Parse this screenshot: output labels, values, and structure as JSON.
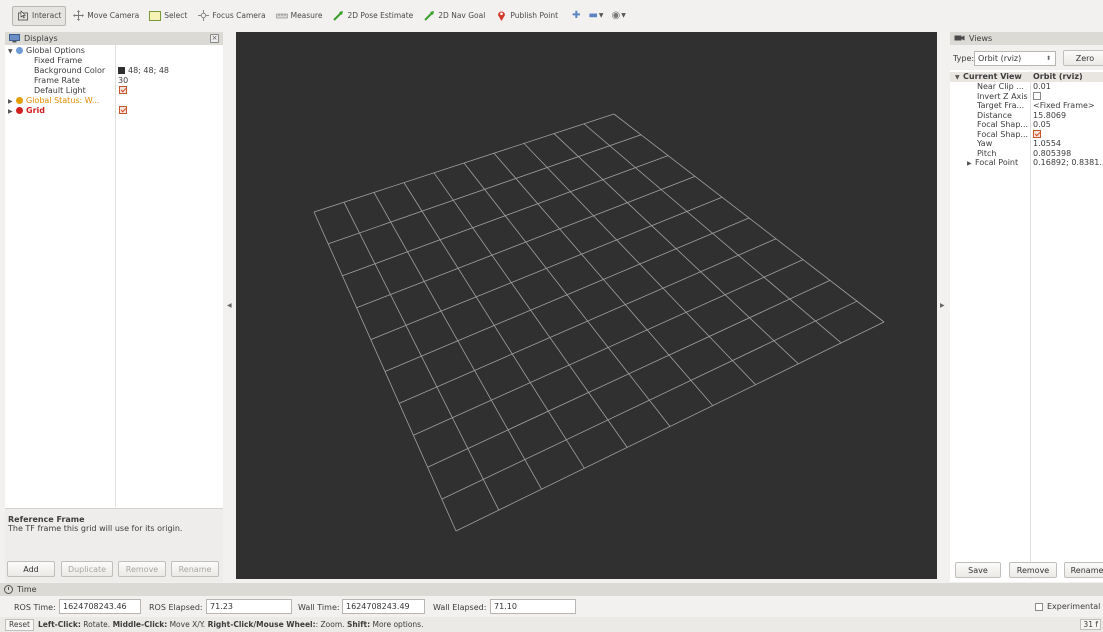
{
  "toolbar": {
    "interact": "Interact",
    "move_camera": "Move Camera",
    "select": "Select",
    "focus_camera": "Focus Camera",
    "measure": "Measure",
    "pose_estimate": "2D Pose Estimate",
    "nav_goal": "2D Nav Goal",
    "publish_point": "Publish Point"
  },
  "displays": {
    "title": "Displays",
    "global_options": "Global Options",
    "fixed_frame": "Fixed Frame",
    "background_color_label": "Background Color",
    "background_color_value": "48; 48; 48",
    "frame_rate_label": "Frame Rate",
    "frame_rate_value": "30",
    "default_light_label": "Default Light",
    "global_status": "Global Status: W...",
    "grid": "Grid",
    "desc_title": "Reference Frame",
    "desc_text": "The TF frame this grid will use for its origin.",
    "buttons": {
      "add": "Add",
      "duplicate": "Duplicate",
      "remove": "Remove",
      "rename": "Rename"
    }
  },
  "views": {
    "title": "Views",
    "type_label": "Type:",
    "type_value": "Orbit (rviz)",
    "zero": "Zero",
    "current_view": "Current View",
    "current_view_value": "Orbit (rviz)",
    "props": [
      {
        "label": "Near Clip ...",
        "value": "0.01"
      },
      {
        "label": "Invert Z Axis",
        "value": ""
      },
      {
        "label": "Target Fra...",
        "value": "<Fixed Frame>"
      },
      {
        "label": "Distance",
        "value": "15.8069"
      },
      {
        "label": "Focal Shap...",
        "value": "0.05"
      },
      {
        "label": "Focal Shap...",
        "value": ""
      },
      {
        "label": "Yaw",
        "value": "1.0554"
      },
      {
        "label": "Pitch",
        "value": "0.805398"
      },
      {
        "label": "Focal Point",
        "value": "0.16892; 0.8381..."
      }
    ],
    "buttons": {
      "save": "Save",
      "remove": "Remove",
      "rename": "Rename"
    }
  },
  "time": {
    "title": "Time",
    "ros_time_label": "ROS Time:",
    "ros_time_value": "1624708243.46",
    "ros_elapsed_label": "ROS Elapsed:",
    "ros_elapsed_value": "71.23",
    "wall_time_label": "Wall Time:",
    "wall_time_value": "1624708243.49",
    "wall_elapsed_label": "Wall Elapsed:",
    "wall_elapsed_value": "71.10",
    "experimental": "Experimental"
  },
  "status": {
    "reset": "Reset",
    "help_left_click": "Left-Click:",
    "help_rotate": " Rotate. ",
    "help_middle_click": "Middle-Click:",
    "help_move": " Move X/Y. ",
    "help_right_click": "Right-Click/Mouse Wheel:",
    "help_zoom": ": Zoom. ",
    "help_shift": "Shift:",
    "help_more": " More options.",
    "fps": "31 f"
  },
  "colors": {
    "viewport_bg": "#303030",
    "grid_line": "#a0a0a0",
    "warning": "#e0a000",
    "error": "#d0201f",
    "accent_blue": "#5a84c2"
  }
}
